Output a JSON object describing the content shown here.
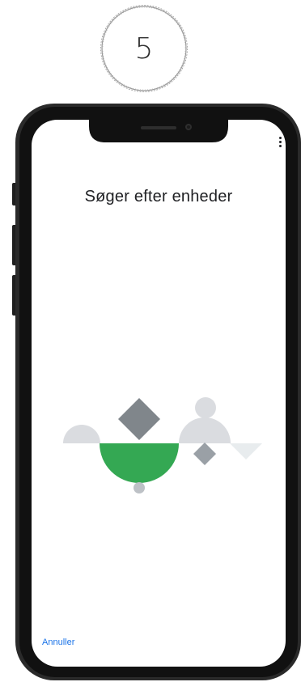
{
  "step": {
    "number": "5"
  },
  "screen": {
    "title": "Søger efter enheder",
    "menu_icon": "more-vert-icon",
    "cancel_label": "Annuller"
  },
  "colors": {
    "accent_green": "#34a853",
    "shape_dark_gray": "#80868b",
    "shape_light_gray": "#dadce0",
    "link_blue": "#1a73e8"
  }
}
